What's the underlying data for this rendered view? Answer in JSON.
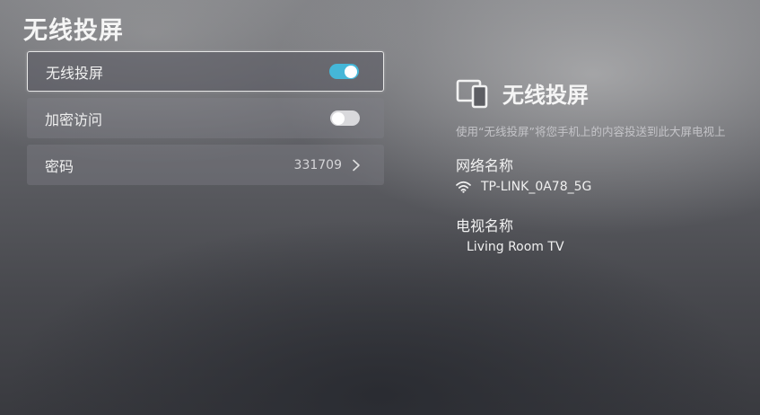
{
  "header": {
    "title": "无线投屏"
  },
  "menu": {
    "items": [
      {
        "label": "无线投屏",
        "toggle": "on"
      },
      {
        "label": "加密访问",
        "toggle": "off"
      },
      {
        "label": "密码",
        "value": "331709"
      }
    ]
  },
  "info": {
    "icon": "screen-cast-icon",
    "title": "无线投屏",
    "description": "使用“无线投屏”将您手机上的内容投送到此大屏电视上",
    "network_label": "网络名称",
    "network_value": "TP-LINK_0A78_5G",
    "network_icon": "wifi-icon",
    "tv_label": "电视名称",
    "tv_value": "Living Room TV"
  },
  "colors": {
    "toggle_on": "#45b7d8",
    "toggle_off": "#d9d9dc"
  }
}
